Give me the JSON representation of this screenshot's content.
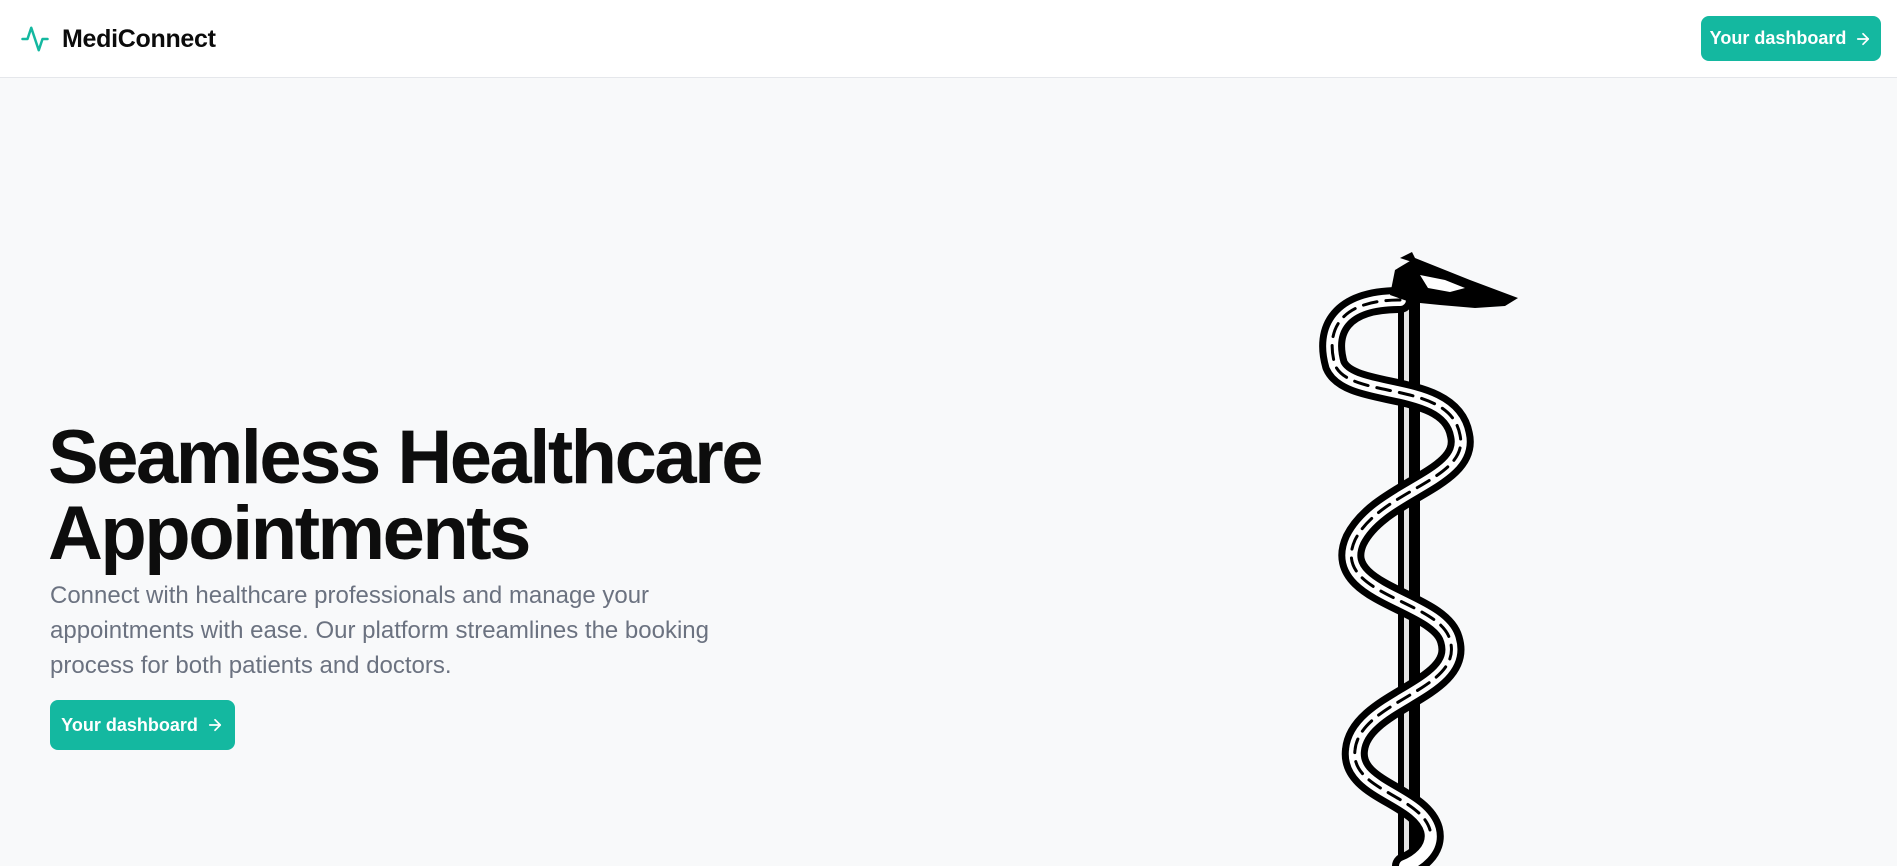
{
  "nav": {
    "brand_name": "MediConnect",
    "brand_icon": "activity-pulse-icon",
    "dashboard_button": "Your dashboard"
  },
  "hero": {
    "title_line1": "Seamless Healthcare",
    "title_line2": "Appointments",
    "description": "Connect with healthcare professionals and manage your appointments with ease. Our platform streamlines the booking process for both patients and doctors.",
    "cta_button": "Your dashboard",
    "illustration": "rod-of-asclepius"
  },
  "colors": {
    "accent": "#14b8a0",
    "background": "#f8f9fa",
    "header": "#ffffff",
    "muted_text": "#6b7280"
  }
}
